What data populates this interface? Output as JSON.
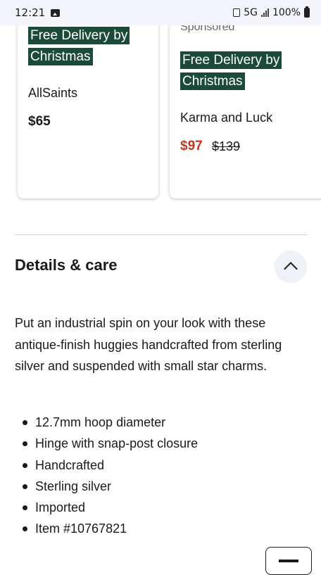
{
  "status_bar": {
    "time": "12:21",
    "network": "5G",
    "battery": "100%"
  },
  "products": [
    {
      "badge": "Free Delivery by Christmas",
      "brand": "AllSaints",
      "price": "$65"
    },
    {
      "sponsored": "Sponsored",
      "badge": "Free Delivery by Christmas",
      "brand": "Karma and Luck",
      "sale_price": "$97",
      "was_price": "$139"
    }
  ],
  "details": {
    "title": "Details & care",
    "description": "Put an industrial spin on your look with these antique-finish huggies handcrafted from sterling silver and suspended with small star charms.",
    "bullets": [
      "12.7mm hoop diameter",
      "Hinge with snap-post closure",
      "Handcrafted",
      "Sterling silver",
      "Imported",
      "Item #10767821"
    ]
  },
  "colors": {
    "badge_bg": "#1c4a3a",
    "sale_price": "#c0391b"
  }
}
